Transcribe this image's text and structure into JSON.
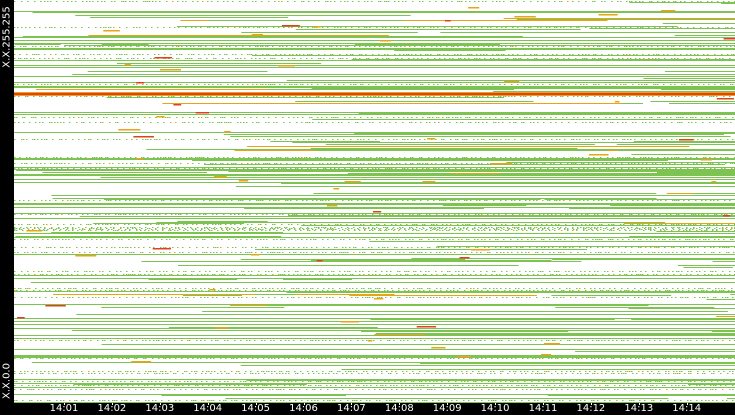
{
  "chart_data": {
    "type": "heatmap",
    "title": "",
    "xlabel": "",
    "ylabel": "",
    "y_tick_labels": {
      "top": "X.X.255.255",
      "bottom": "X.X.0.0"
    },
    "x_tick_labels": [
      "14:01",
      "14:02",
      "14:03",
      "14:04",
      "14:05",
      "14:06",
      "14:07",
      "14:08",
      "14:09",
      "14:10",
      "14:11",
      "14:12",
      "14:13",
      "14:14"
    ],
    "colors": {
      "low": "#7dc352",
      "mid": "#e8a317",
      "high": "#e0401a"
    },
    "highlight_band": {
      "address_fraction_from_top": 0.23,
      "color": "#e0401a"
    }
  }
}
